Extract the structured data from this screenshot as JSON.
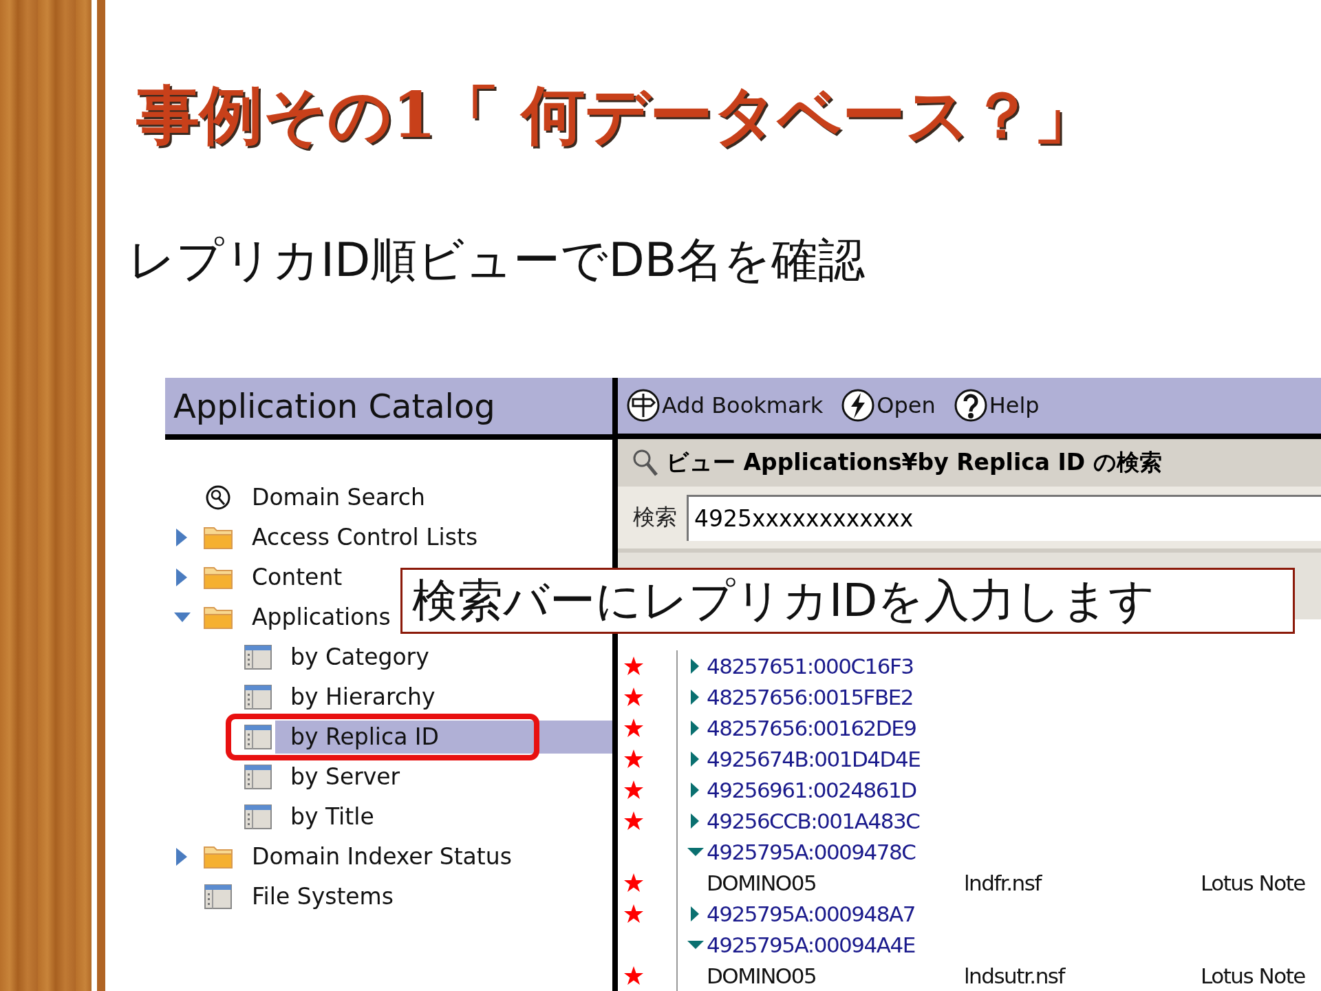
{
  "slide": {
    "title": "事例その1「 何データベース？」",
    "subtitle": "レプリカID順ビューでDB名を確認"
  },
  "screenshot": {
    "catalog_title": "Application Catalog",
    "tree": [
      {
        "kind": "search",
        "label": "Domain Search"
      },
      {
        "kind": "folder",
        "label": "Access Control Lists",
        "expanded": false
      },
      {
        "kind": "folder",
        "label": "Content",
        "expanded": false
      },
      {
        "kind": "folder",
        "label": "Applications",
        "expanded": true,
        "children": [
          {
            "kind": "view",
            "label": "by Category",
            "selected": false
          },
          {
            "kind": "view",
            "label": "by Hierarchy",
            "selected": false
          },
          {
            "kind": "view",
            "label": "by Replica ID",
            "selected": true
          },
          {
            "kind": "view",
            "label": "by Server",
            "selected": false
          },
          {
            "kind": "view",
            "label": "by Title",
            "selected": false
          }
        ]
      },
      {
        "kind": "folder",
        "label": "Domain Indexer Status",
        "expanded": false
      },
      {
        "kind": "view",
        "label": "File Systems",
        "selected": false
      }
    ],
    "toolbar": [
      {
        "kind": "bookmark",
        "label": "Add Bookmark"
      },
      {
        "kind": "open",
        "label": "Open"
      },
      {
        "kind": "help",
        "label": "Help"
      }
    ],
    "search": {
      "title": "ビュー Applications¥by Replica ID の検索",
      "label": "検索",
      "value": "4925xxxxxxxxxxxx"
    },
    "rows": [
      {
        "kind": "category",
        "starred": true,
        "expanded": false,
        "id": "48257651:000C16F3"
      },
      {
        "kind": "category",
        "starred": true,
        "expanded": false,
        "id": "48257656:0015FBE2"
      },
      {
        "kind": "category",
        "starred": true,
        "expanded": false,
        "id": "48257656:00162DE9"
      },
      {
        "kind": "category",
        "starred": true,
        "expanded": false,
        "id": "4925674B:001D4D4E"
      },
      {
        "kind": "category",
        "starred": true,
        "expanded": false,
        "id": "49256961:0024861D"
      },
      {
        "kind": "category",
        "starred": true,
        "expanded": false,
        "id": "49256CCB:001A483C"
      },
      {
        "kind": "category",
        "starred": false,
        "expanded": true,
        "id": "4925795A:0009478C"
      },
      {
        "kind": "document",
        "starred": true,
        "cells": [
          "DOMINO05",
          "lndfr.nsf",
          "Lotus Note"
        ]
      },
      {
        "kind": "category",
        "starred": true,
        "expanded": false,
        "id": "4925795A:000948A7"
      },
      {
        "kind": "category",
        "starred": false,
        "expanded": true,
        "id": "4925795A:00094A4E"
      },
      {
        "kind": "document",
        "starred": true,
        "cells": [
          "DOMINO05",
          "lndsutr.nsf",
          "Lotus Note"
        ]
      }
    ],
    "callout": "検索バーにレプリカIDを入力します"
  }
}
